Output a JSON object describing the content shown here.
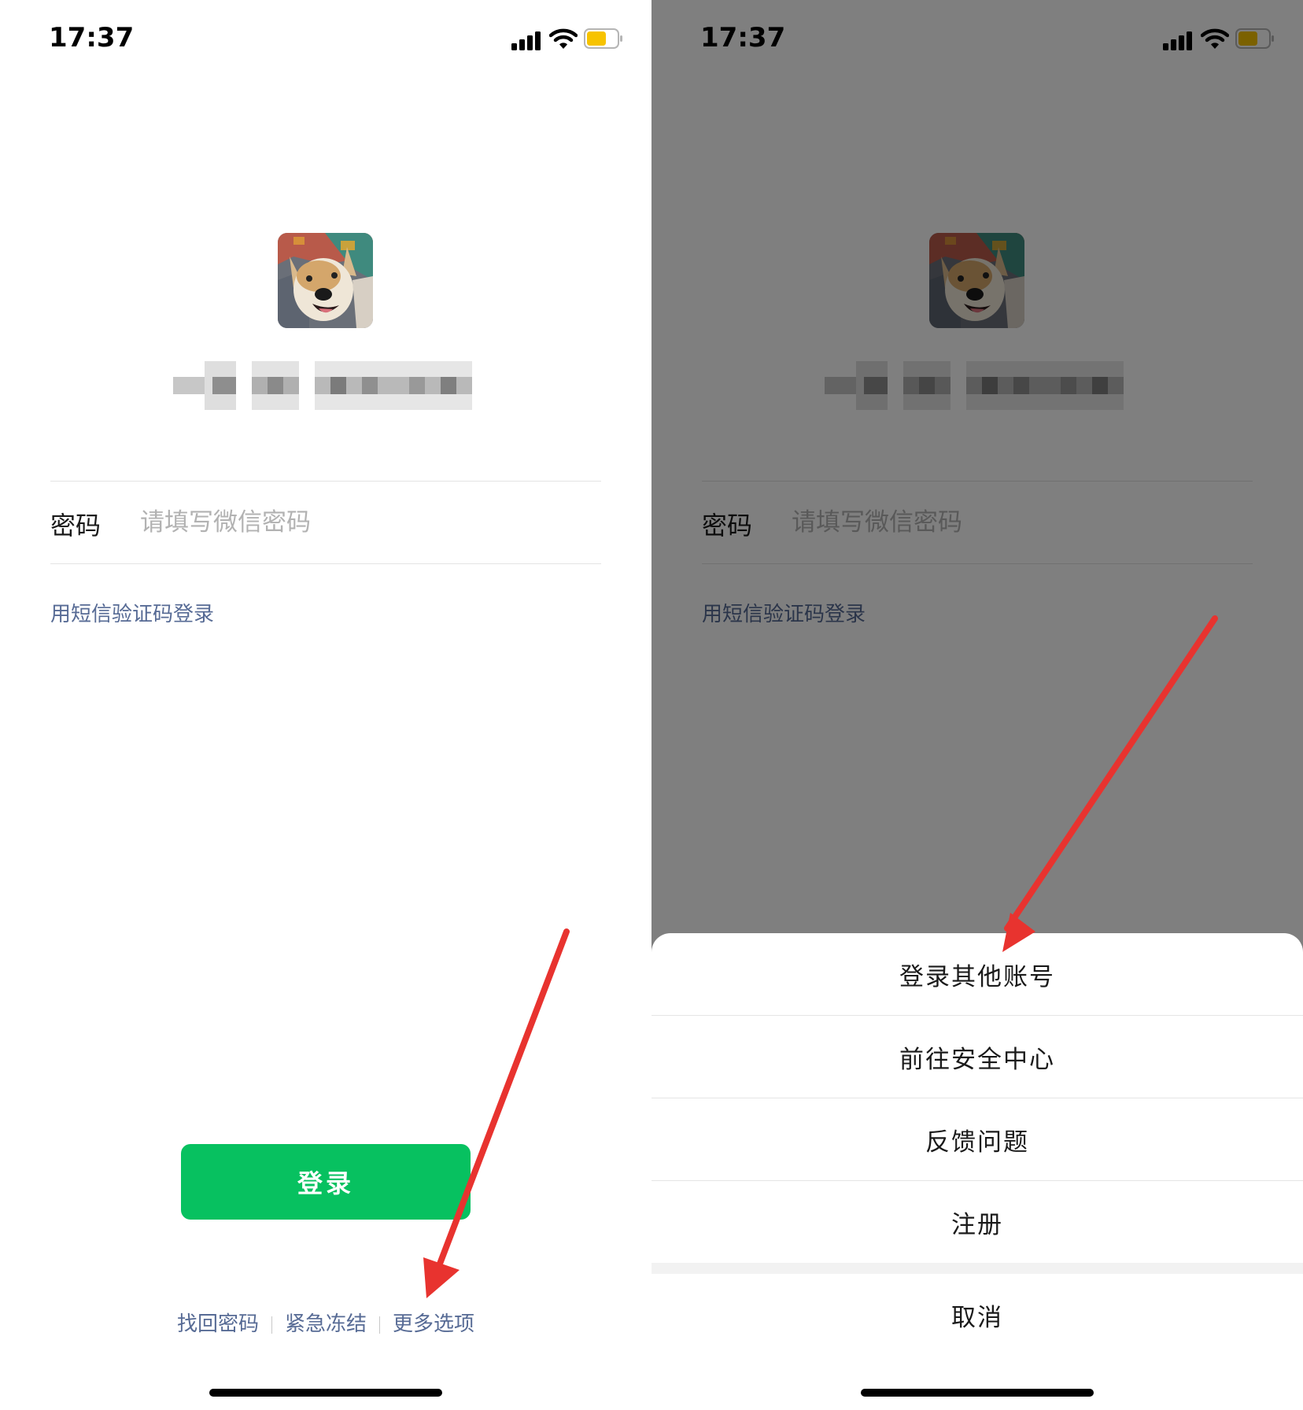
{
  "status_bar": {
    "time": "17:37"
  },
  "login": {
    "password_label": "密码",
    "password_placeholder": "请填写微信密码",
    "sms_login": "用短信验证码登录",
    "login_button": "登录",
    "links": [
      "找回密码",
      "紧急冻结",
      "更多选项"
    ]
  },
  "action_sheet": {
    "items": [
      "登录其他账号",
      "前往安全中心",
      "反馈问题",
      "注册"
    ],
    "cancel": "取消"
  },
  "colors": {
    "accent_green": "#07c160",
    "link_blue": "#576b95",
    "arrow_red": "#e8332f",
    "battery_yellow": "#f7c300"
  },
  "icons": [
    "signal-icon",
    "wifi-icon",
    "battery-icon",
    "arrow-annotation"
  ]
}
